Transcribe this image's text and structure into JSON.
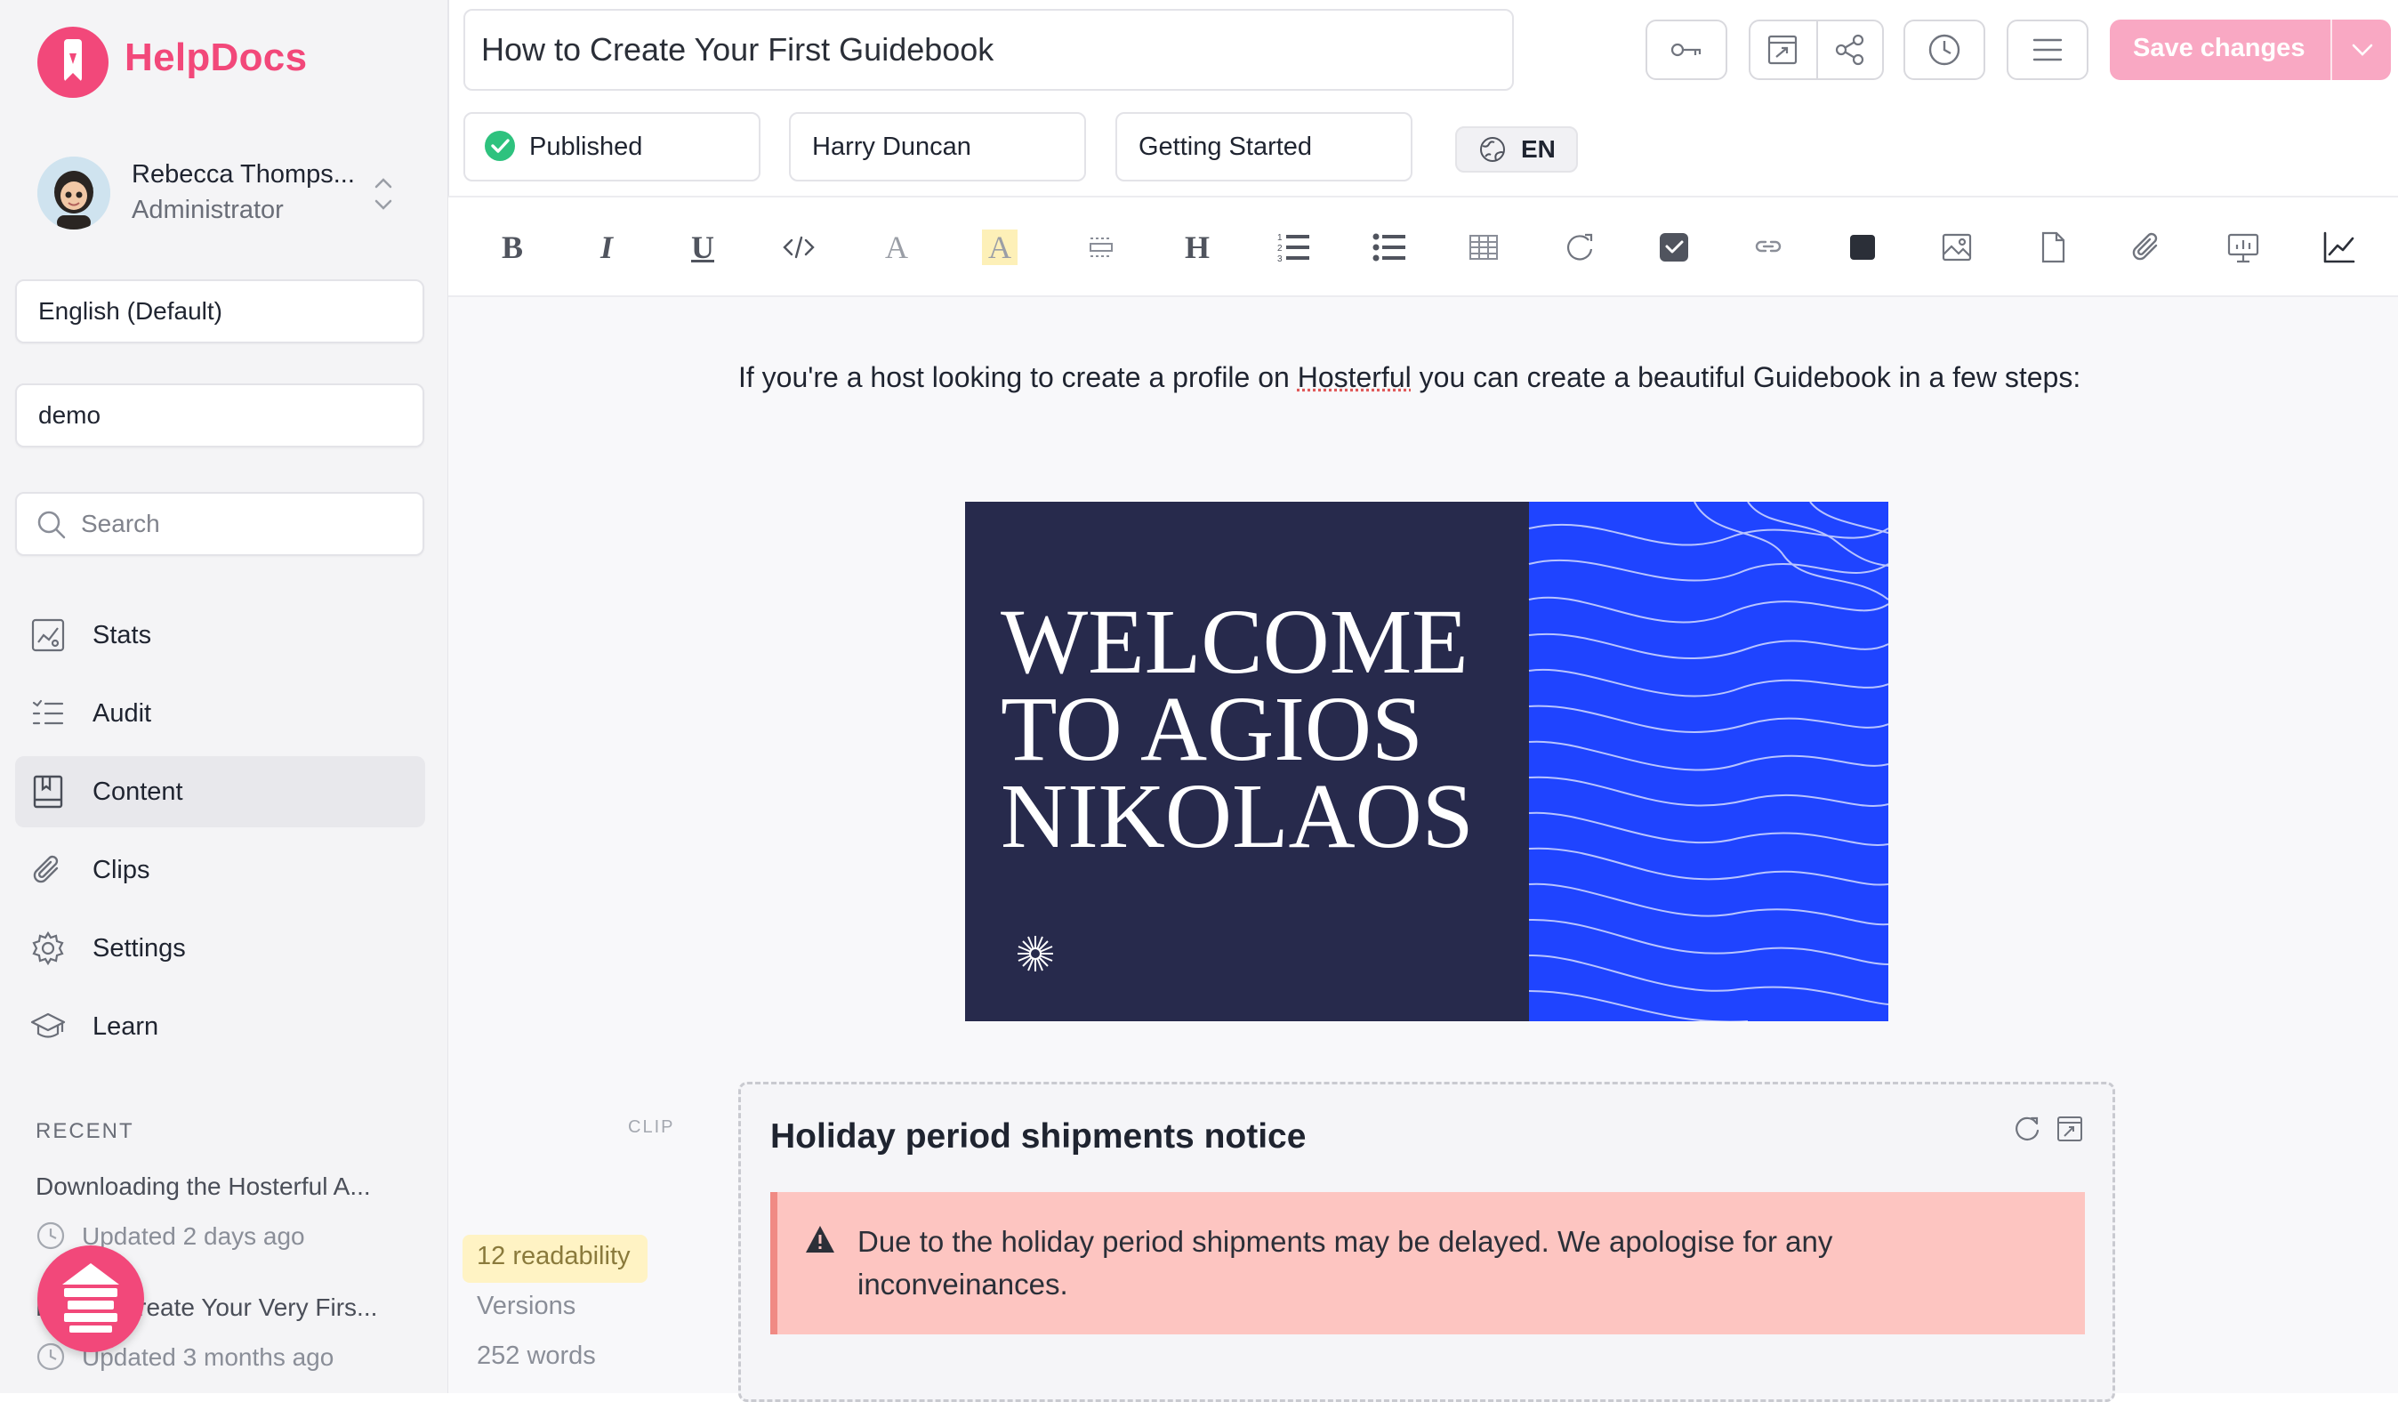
{
  "brand": {
    "name": "HelpDocs",
    "accent": "#f2487a"
  },
  "user": {
    "name": "Rebecca Thomps...",
    "role": "Administrator"
  },
  "sidebar": {
    "language": "English (Default)",
    "project": "demo",
    "search_placeholder": "Search",
    "nav": [
      {
        "label": "Stats",
        "icon": "stats-icon"
      },
      {
        "label": "Audit",
        "icon": "audit-list-icon"
      },
      {
        "label": "Content",
        "icon": "book-icon",
        "active": true
      },
      {
        "label": "Clips",
        "icon": "paperclip-icon"
      },
      {
        "label": "Settings",
        "icon": "gear-icon"
      },
      {
        "label": "Learn",
        "icon": "graduation-cap-icon"
      }
    ],
    "recent_title": "RECENT",
    "recent": [
      {
        "title": "Downloading the Hosterful A...",
        "updated": "Updated 2 days ago"
      },
      {
        "title": "How to Create Your Very Firs...",
        "updated": "Updated 3 months ago"
      }
    ]
  },
  "article": {
    "title": "How to Create Your First Guidebook",
    "status": "Published",
    "author": "Harry Duncan",
    "category": "Getting Started",
    "language": "EN"
  },
  "toolbar": {
    "save_label": "Save changes"
  },
  "editor": {
    "para_before": "If you're a host looking to create a profile on ",
    "para_brand": "Hosterful",
    "para_after": " you can create a beautiful Guidebook in a few steps:",
    "hero_lines": [
      "WELCOME",
      "TO AGIOS",
      "NIKOLAOS"
    ],
    "clip_tag": "CLIP",
    "clip_title": "Holiday period shipments notice",
    "alert_text": "Due to the holiday period shipments may be delayed. We apologise for any inconveinances."
  },
  "stats": {
    "readability": "12 readability",
    "versions": "Versions",
    "words": "252 words"
  },
  "colors": {
    "save_button": "#f9a8c3",
    "alert_bg": "#fdc5c1",
    "hero_dark": "#272a4c",
    "hero_blue": "#1f44ff"
  }
}
